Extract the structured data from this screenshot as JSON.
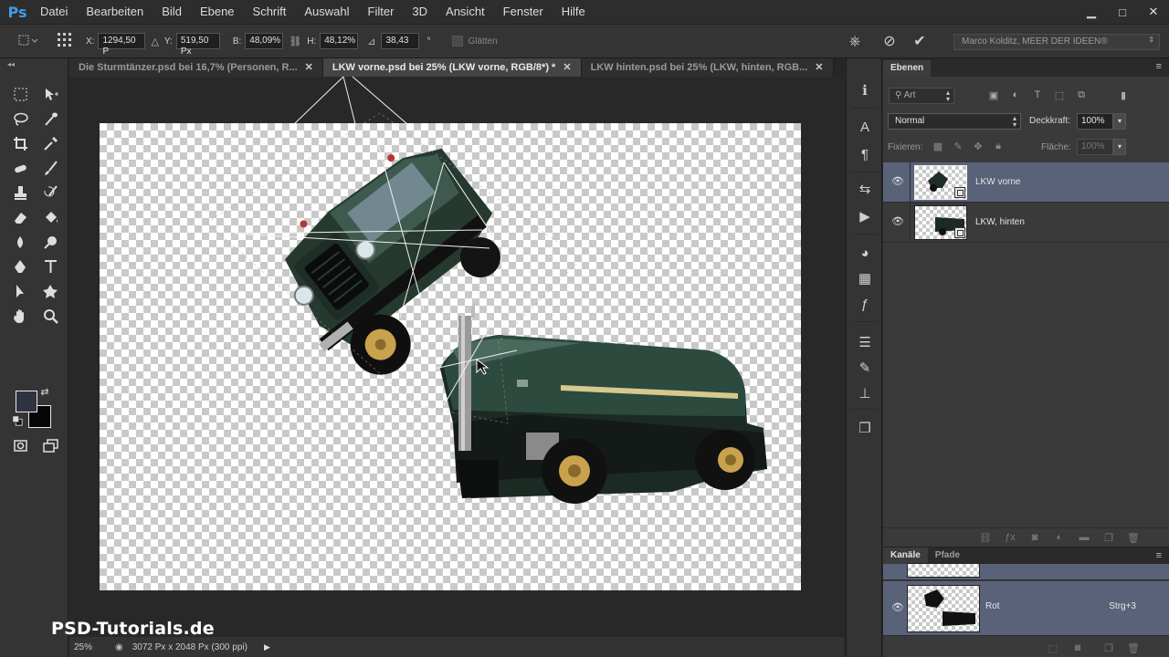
{
  "app": {
    "logo": "Ps"
  },
  "menu": [
    "Datei",
    "Bearbeiten",
    "Bild",
    "Ebene",
    "Schrift",
    "Auswahl",
    "Filter",
    "3D",
    "Ansicht",
    "Fenster",
    "Hilfe"
  ],
  "window_controls": {
    "minimize": "▁",
    "maximize": "□",
    "close": "✕"
  },
  "options": {
    "x_label": "X:",
    "x_value": "1294,50 P",
    "y_label": "Y:",
    "y_value": "519,50 Px",
    "w_label": "B:",
    "w_value": "48,09%",
    "h_label": "H:",
    "h_value": "48,12%",
    "angle_value": "38,43",
    "angle_unit": "°",
    "smooth_label": "Glätten",
    "workspace": "Marco Kolditz, MEER DER IDEEN®"
  },
  "tabs": [
    {
      "label": "Die Sturmtänzer.psd bei 16,7% (Personen, R...",
      "close": "✕"
    },
    {
      "label": "LKW vorne.psd bei 25% (LKW vorne, RGB/8*) *",
      "close": "✕"
    },
    {
      "label": "LKW hinten.psd bei 25% (LKW, hinten, RGB...",
      "close": "✕"
    }
  ],
  "colors": {
    "foreground": "#2e3340",
    "background": "#050505",
    "selection": "#596279",
    "accent": "#3d9be9"
  },
  "status": {
    "zoom": "25%",
    "doc_info": "3072 Px x 2048 Px (300 ppi)"
  },
  "watermark": "PSD-Tutorials.de",
  "layers_panel": {
    "tab": "Ebenen",
    "filter": "Art",
    "blend_mode": "Normal",
    "opacity_label": "Deckkraft:",
    "opacity_value": "100%",
    "lock_label": "Fixieren:",
    "fill_label": "Fläche:",
    "fill_value": "100%",
    "layers": [
      {
        "name": "LKW vorne",
        "selected": true
      },
      {
        "name": "LKW, hinten",
        "selected": false
      }
    ]
  },
  "channels_panel": {
    "tabs": [
      "Kanäle",
      "Pfade"
    ],
    "channel": {
      "name": "Rot",
      "shortcut": "Strg+3"
    }
  },
  "icons": {
    "tools": [
      "marquee-icon",
      "move-icon",
      "lasso-icon",
      "quick-select-icon",
      "crop-icon",
      "eyedropper-icon",
      "healing-icon",
      "brush-icon",
      "stamp-icon",
      "history-brush-icon",
      "eraser-icon",
      "bucket-icon",
      "blur-icon",
      "dodge-icon",
      "pen-icon",
      "type-icon",
      "path-select-icon",
      "shape-icon",
      "hand-icon",
      "zoom-icon"
    ],
    "strip": [
      "info-icon",
      "character-icon",
      "paragraph-icon",
      "history-icon",
      "actions-icon",
      "swatches-icon",
      "color-icon",
      "styles-icon",
      "adjustments-icon",
      "brushes-icon",
      "clone-source-icon",
      "3d-icon"
    ]
  }
}
